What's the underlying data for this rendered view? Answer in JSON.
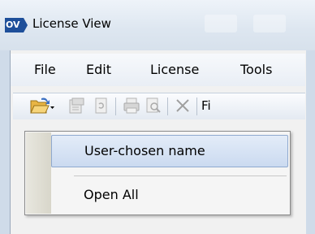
{
  "window": {
    "title": "License View",
    "logo_text": "OV"
  },
  "menubar": {
    "items": [
      "File",
      "Edit",
      "License",
      "Tools"
    ]
  },
  "toolbar": {
    "cut_off_label": "Fi"
  },
  "dropdown": {
    "items": [
      {
        "label": "User-chosen name",
        "highlighted": true
      },
      {
        "label": "Open All",
        "highlighted": false
      }
    ]
  },
  "colors": {
    "highlight": "#cbdaf0",
    "logo": "#1e4f9a"
  }
}
